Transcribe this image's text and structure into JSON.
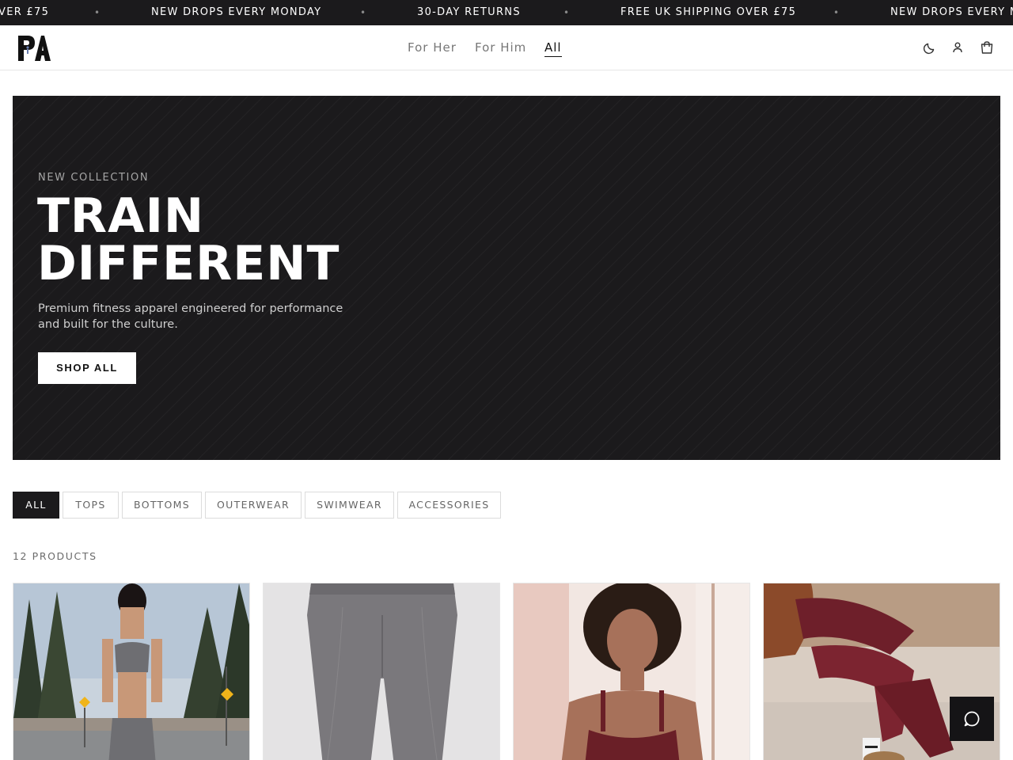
{
  "announcements": {
    "items": [
      "VER £75",
      "NEW DROPS EVERY MONDAY",
      "30-DAY RETURNS",
      "FREE UK SHIPPING OVER £75",
      "NEW DROPS EVERY MO"
    ],
    "separator": "•"
  },
  "header": {
    "logo_text": "PA",
    "nav": [
      {
        "label": "For Her",
        "active": false
      },
      {
        "label": "For Him",
        "active": false
      },
      {
        "label": "All",
        "active": true
      }
    ],
    "icons": [
      "moon-icon",
      "user-icon",
      "bag-icon"
    ]
  },
  "hero": {
    "eyebrow": "NEW COLLECTION",
    "title_line1": "TRAIN",
    "title_line2": "DIFFERENT",
    "subtitle": "Premium fitness apparel engineered for performance and built for the culture.",
    "cta": "SHOP ALL"
  },
  "filters": [
    {
      "label": "ALL",
      "active": true
    },
    {
      "label": "TOPS",
      "active": false
    },
    {
      "label": "BOTTOMS",
      "active": false
    },
    {
      "label": "OUTERWEAR",
      "active": false
    },
    {
      "label": "SWIMWEAR",
      "active": false
    },
    {
      "label": "ACCESSORIES",
      "active": false
    }
  ],
  "product_count": "12 PRODUCTS",
  "colors": {
    "dark": "#1b1a1c",
    "hero_bg": "#1b1a1c",
    "muted_nav": "#777777"
  }
}
